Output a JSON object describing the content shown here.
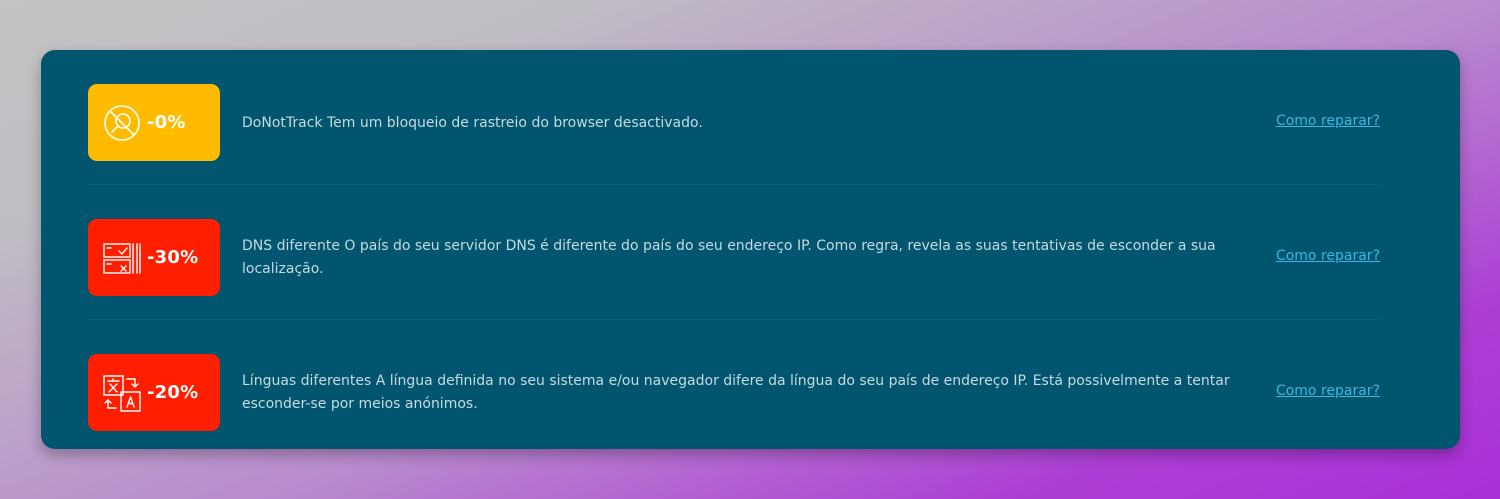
{
  "colors": {
    "card_bg": "#01556e",
    "badge_warning": "#ffbb00",
    "badge_danger": "#ff1e00",
    "link": "#3fb6dc",
    "text": "#c5dae1"
  },
  "checks": [
    {
      "icon": "no-tracking-icon",
      "badge_color": "#ffbb00",
      "percent": "-0%",
      "description": "DoNotTrack Tem um bloqueio de rastreio do browser desactivado.",
      "link": "Como reparar?"
    },
    {
      "icon": "dns-servers-icon",
      "badge_color": "#ff1e00",
      "percent": "-30%",
      "description": "DNS diferente O país do seu servidor DNS é diferente do país do seu endereço IP. Como regra, revela as suas tentativas de esconder a sua localização.",
      "link": "Como reparar?"
    },
    {
      "icon": "language-translate-icon",
      "badge_color": "#ff1e00",
      "percent": "-20%",
      "description": "Línguas diferentes A língua definida no seu sistema e/ou navegador difere da língua do seu país de endereço IP. Está possivelmente a tentar esconder-se por meios anónimos.",
      "link": "Como reparar?"
    }
  ]
}
